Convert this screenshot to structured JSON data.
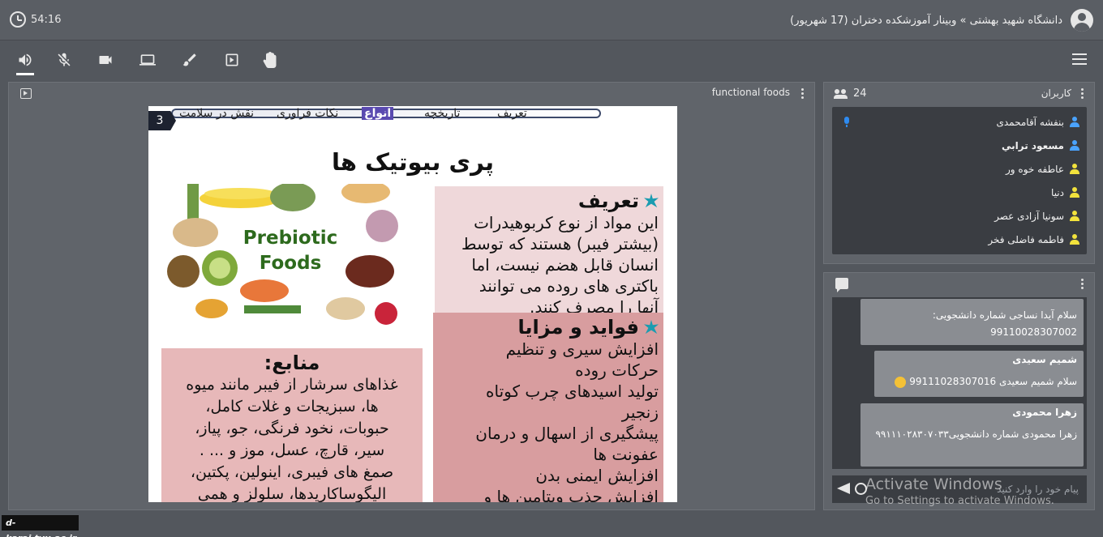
{
  "header": {
    "timer": "54:16",
    "session_title": "دانشگاه شهید بهشتی » وبینار آموزشکده دختران (17 شهریور)"
  },
  "toolbar": {
    "tools": [
      "speaker-icon",
      "mic-off-icon",
      "camera-icon",
      "screen-share-icon",
      "brush-icon",
      "play-box-icon",
      "raise-hand-icon"
    ],
    "menu": "hamburger-icon"
  },
  "presentation": {
    "name": "functional foods",
    "slide": {
      "number": "3",
      "nav": [
        "نقش در سلامت",
        "نکات فراوری",
        "انواع",
        "تاریخچه",
        "تعریف"
      ],
      "heading": "پری بیوتیک ها",
      "image_label_line1": "Prebiotic",
      "image_label_line2": "Foods",
      "definition": {
        "title": "تعریف",
        "text": "این مواد از نوع کربوهیدرات\n(بیشتر فیبر) هستند که توسط\nانسان قابل هضم نیست، اما\nباکتری های روده می توانند\nآنها را مصرف کنند."
      },
      "benefits": {
        "title": "فواید و مزایا",
        "text": "افزایش سیری و تنظیم\nحرکات روده\nتولید اسیدهای چرب کوتاه\nزنجیر\nپیشگیری از اسهال و درمان\nعفونت ها\nافزایش ایمنی بدن\nافزایش جذب ویتامین ها و"
      },
      "sources": {
        "title": "منابع:",
        "text": "غذاهای سرشار از فیبر مانند میوه\nها، سبزیجات و غلات کامل،\nحبوبات، نخود فرنگی، جو، پیاز،\nسیر، قارچ، عسل، موز و ... .\nصمغ های فیبری، اینولین، پکتین،\nالیگوساکاریدها، سلولز و همی"
      }
    }
  },
  "users": {
    "count": "24",
    "label": "کاربران",
    "list": [
      {
        "name": "بنفشه آقامحمدی",
        "role": "moderator",
        "color": "#4aa3ff"
      },
      {
        "name": "مسعود ترابي",
        "role": "moderator",
        "color": "#4aa3ff"
      },
      {
        "name": "عاطفه خوه ور",
        "role": "viewer",
        "color": "#f2e23c"
      },
      {
        "name": "دنیا",
        "role": "viewer",
        "color": "#f2e23c"
      },
      {
        "name": "سونیا آزادی عصر",
        "role": "viewer",
        "color": "#f2e23c"
      },
      {
        "name": "فاطمه فاضلی فخر",
        "role": "viewer",
        "color": "#f2e23c"
      }
    ]
  },
  "chat": {
    "messages": [
      {
        "name": "",
        "text_line1": "سلام آیدا نساجی  شماره دانشجویی:",
        "text_line2": "99110028307002"
      },
      {
        "name": "شمیم سعیدی",
        "text_line1": "سلام شمیم سعیدی 99111028307016",
        "text_line2": ""
      },
      {
        "name": "زهرا محمودی",
        "text_line1": "زهرا محمودی شماره دانشجویی۹۹۱۱۱۰۲۸۳۰۷۰۳۳",
        "text_line2": ""
      }
    ],
    "placeholder": "پیام خود را وارد کنید"
  },
  "watermark": {
    "title": "Activate Windows",
    "subtitle": "Go to Settings to activate Windows."
  },
  "logo": "d-karaj.tvu.ac.ir"
}
